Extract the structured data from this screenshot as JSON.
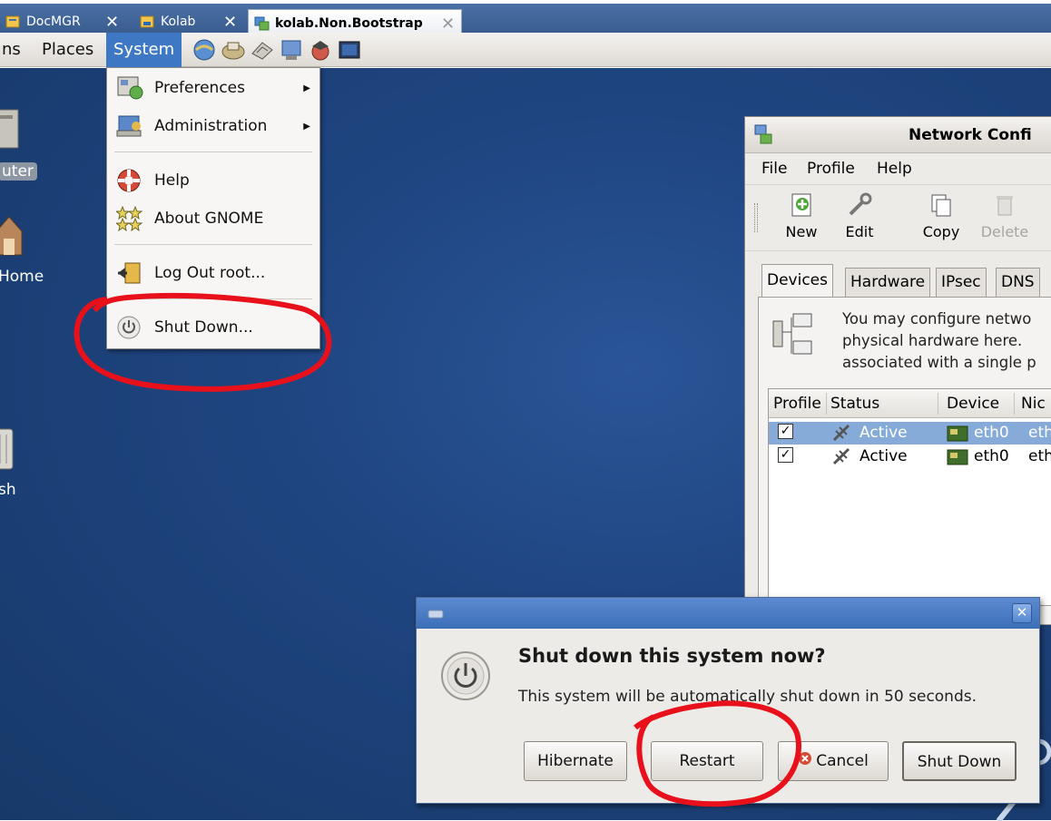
{
  "tabs": [
    {
      "label": "DocMGR",
      "close": "✕"
    },
    {
      "label": "Kolab",
      "close": "✕"
    },
    {
      "label": "kolab.Non.Bootstrap",
      "close": "✕"
    }
  ],
  "panel": {
    "applications_label": "ns",
    "places_label": "Places",
    "system_label": "System"
  },
  "desktop": {
    "icons": [
      "uter",
      "Home",
      "sh"
    ]
  },
  "system_menu": {
    "items": [
      {
        "label": "Preferences",
        "arrow": "▶"
      },
      {
        "label": "Administration",
        "arrow": "▶"
      },
      {
        "label": "Help"
      },
      {
        "label": "About GNOME"
      },
      {
        "label": "Log Out root..."
      },
      {
        "label": "Shut Down..."
      }
    ]
  },
  "network_window": {
    "title": "Network Confi",
    "menubar": [
      "File",
      "Profile",
      "Help"
    ],
    "toolbar": [
      "New",
      "Edit",
      "Copy",
      "Delete"
    ],
    "tabs": [
      "Devices",
      "Hardware",
      "IPsec",
      "DNS"
    ],
    "description": [
      "You may configure netwo",
      "physical hardware here.",
      "associated with a single p"
    ],
    "table": {
      "columns": [
        "Profile",
        "Status",
        "Device",
        "Nic"
      ],
      "rows": [
        {
          "checked": "✓",
          "status": "Active",
          "device": "eth0",
          "nick": "eth"
        },
        {
          "checked": "✓",
          "status": "Active",
          "device": "eth0",
          "nick": "eth"
        }
      ]
    }
  },
  "dialog": {
    "close": "✕",
    "heading": "Shut down this system now?",
    "message": "This system will be automatically shut down in 50 seconds.",
    "buttons": {
      "hibernate": "Hibernate",
      "restart": "Restart",
      "cancel": "Cancel",
      "shutdown": "Shut Down"
    }
  },
  "colors": {
    "selection_blue": "#3e78c4",
    "desktop_blue": "#1f4581",
    "annotation_red": "#e8101a"
  }
}
